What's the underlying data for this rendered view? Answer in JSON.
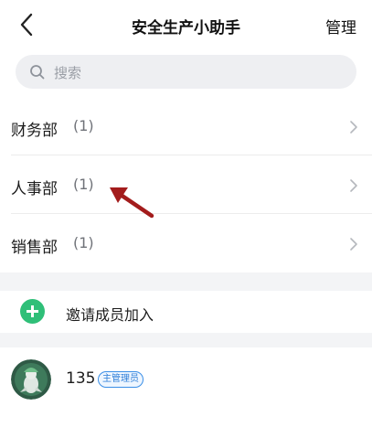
{
  "header": {
    "title": "安全生产小助手",
    "manage_label": "管理"
  },
  "search": {
    "placeholder": "搜索"
  },
  "departments": [
    {
      "name": "财务部",
      "count": "(1)"
    },
    {
      "name": "人事部",
      "count": "(1)"
    },
    {
      "name": "销售部",
      "count": "(1)"
    }
  ],
  "invite": {
    "label": "邀请成员加入"
  },
  "member": {
    "name": "135",
    "badge": "主管理员"
  },
  "colors": {
    "accent_green": "#2fbf78",
    "badge_blue": "#2f7fd8",
    "annotation_arrow": "#a31c1c"
  },
  "icons": {
    "back": "chevron-left-icon",
    "search": "search-icon",
    "row_chevron": "chevron-right-icon",
    "invite": "plus-circle-icon"
  }
}
